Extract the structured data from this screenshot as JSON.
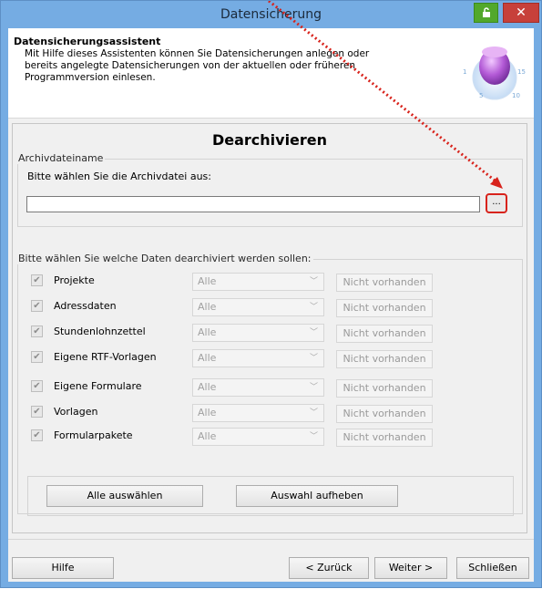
{
  "window": {
    "title": "Datensicherung",
    "close_symbol": "✕"
  },
  "header": {
    "title": "Datensicherungsassistent",
    "description": "Mit Hilfe dieses Assistenten können Sie Datensicherungen anlegen oder bereits angelegte Datensicherungen von der aktuellen oder früheren Programmversion einlesen.",
    "icon": "dial-knob-icon",
    "dial_labels": [
      "1",
      "15",
      "5",
      "10"
    ]
  },
  "panel": {
    "title": "Dearchivieren",
    "archive": {
      "legend": "Archivdateiname",
      "prompt": "Bitte wählen Sie die Archivdatei aus:",
      "value": "",
      "browse_label": "..."
    },
    "data": {
      "legend": "Bitte wählen Sie welche Daten dearchiviert werden sollen:",
      "rows": [
        {
          "label": "Projekte",
          "checked": true,
          "combo": "Alle",
          "status": "Nicht vorhanden"
        },
        {
          "label": "Adressdaten",
          "checked": true,
          "combo": "Alle",
          "status": "Nicht vorhanden"
        },
        {
          "label": "Stundenlohnzettel",
          "checked": true,
          "combo": "Alle",
          "status": "Nicht vorhanden"
        },
        {
          "label": "Eigene RTF-Vorlagen",
          "checked": true,
          "combo": "Alle",
          "status": "Nicht vorhanden"
        },
        {
          "label": "Eigene Formulare",
          "checked": true,
          "combo": "Alle",
          "status": "Nicht vorhanden"
        },
        {
          "label": "Vorlagen",
          "checked": true,
          "combo": "Alle",
          "status": "Nicht vorhanden"
        },
        {
          "label": "Formularpakete",
          "checked": true,
          "combo": "Alle",
          "status": "Nicht vorhanden"
        }
      ]
    },
    "select_all": "Alle auswählen",
    "deselect_all": "Auswahl aufheben"
  },
  "footer": {
    "help": "Hilfe",
    "back": "< Zurück",
    "next": "Weiter >",
    "close": "Schließen"
  },
  "colors": {
    "title_bar": "#75ace3",
    "highlight": "#d8231c",
    "pin_button": "#52a82b",
    "close_button": "#c7403a"
  }
}
